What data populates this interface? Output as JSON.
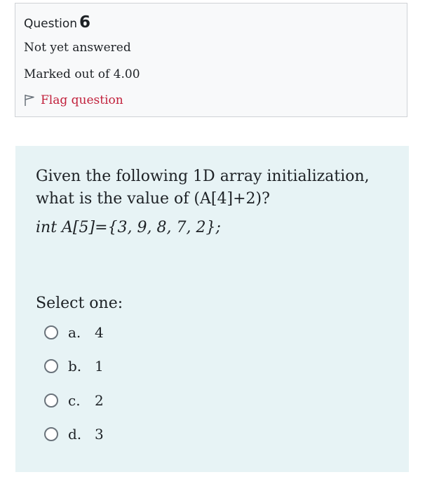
{
  "info": {
    "question_label": "Question",
    "question_number": "6",
    "state": "Not yet answered",
    "grade": "Marked out of 4.00",
    "flag_label": "Flag question"
  },
  "question": {
    "text": "Given the following 1D array initialization, what is the value of (A[4]+2)?",
    "code": "int A[5]={3, 9, 8, 7, 2};",
    "prompt": "Select one:",
    "options": [
      {
        "letter": "a.",
        "text": "4"
      },
      {
        "letter": "b.",
        "text": "1"
      },
      {
        "letter": "c.",
        "text": "2"
      },
      {
        "letter": "d.",
        "text": "3"
      }
    ]
  },
  "colors": {
    "info_background": "#f8f9fa",
    "content_background": "#e7f3f5",
    "flag_color": "#c11f3a"
  }
}
